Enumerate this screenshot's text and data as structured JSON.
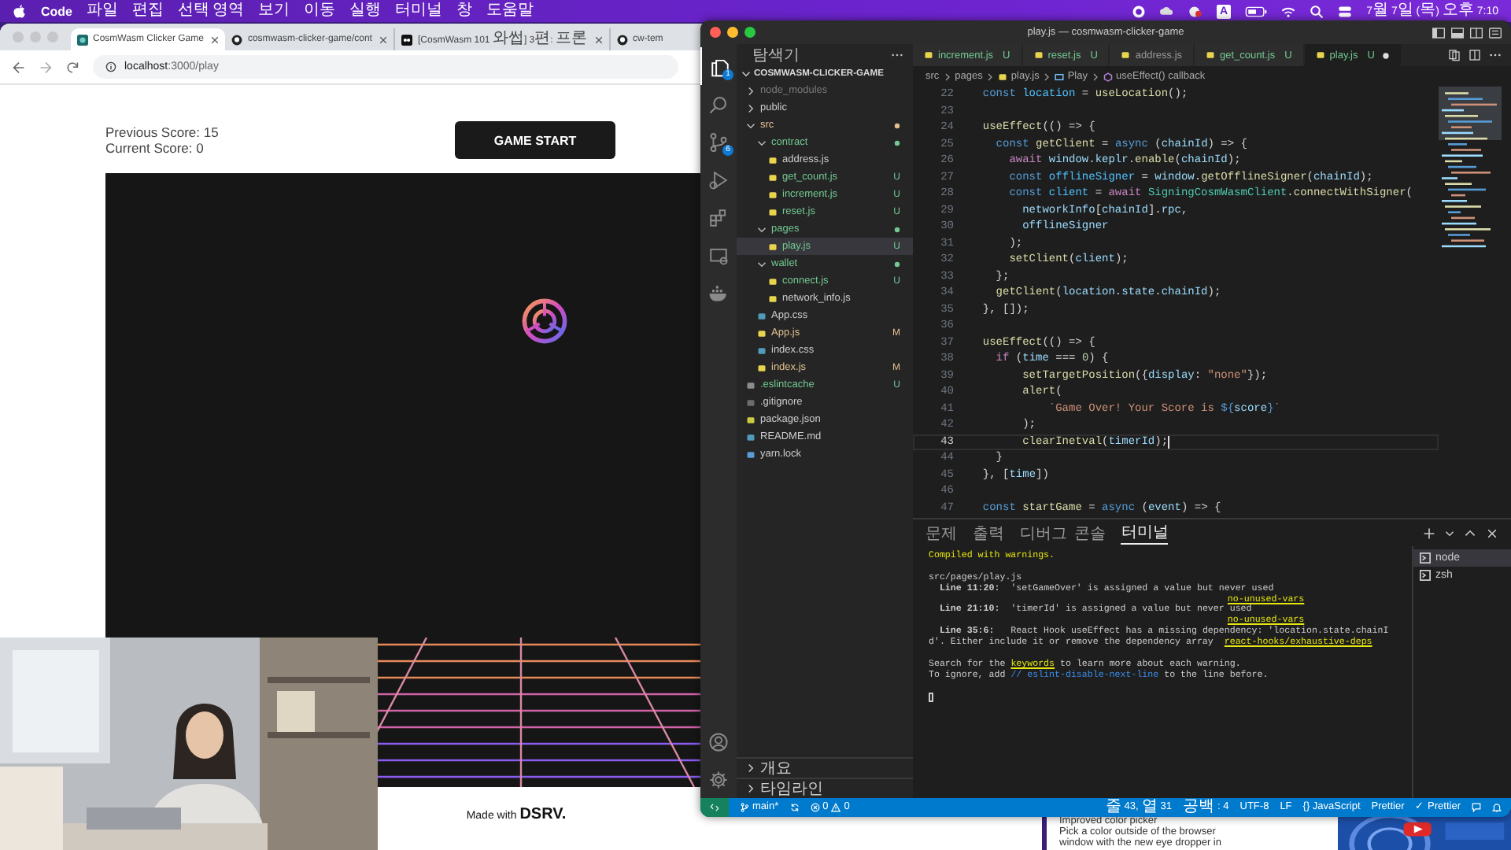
{
  "menu_bar": {
    "app": "Code",
    "items": [
      "파일",
      "편집",
      "선택 영역",
      "보기",
      "이동",
      "실행",
      "터미널",
      "창",
      "도움말"
    ],
    "input_source": "A",
    "clock": "7월 7일 (목) 오후 7:10"
  },
  "browser": {
    "tabs": [
      {
        "title": "CosmWasm Clicker Game",
        "selected": true
      },
      {
        "title": "cosmwasm-clicker-game/cont",
        "selected": false
      },
      {
        "title": "[CosmWasm 101 와썹] 3편: 프론",
        "selected": false
      },
      {
        "title": "cw-tem",
        "selected": false
      }
    ],
    "url": "**localhost**:3000/play",
    "page": {
      "previous_score": "Previous Score: 15",
      "current_score": "Current Score: 0",
      "start_button": "GAME START",
      "footer": "Made with **DSRV.**"
    }
  },
  "background_window": {
    "lines": [
      "Improved color picker",
      "Pick a color outside of the browser",
      "window with the new eye dropper in"
    ]
  },
  "vscode": {
    "title": "play.js — cosmwasm-clicker-game",
    "activity": [
      {
        "selected": true,
        "badge": "1"
      },
      {
        "selected": false
      },
      {
        "selected": false,
        "badge": "6"
      },
      {
        "selected": false
      },
      {
        "selected": false
      },
      {
        "selected": false
      },
      {
        "selected": false
      }
    ],
    "explorer": {
      "title": "탐색기",
      "project": "COSMWASM-CLICKER-GAME",
      "tree": [
        {
          "name": "node_modules",
          "kind": "folder",
          "expanded": false,
          "ignored": true,
          "selected": false
        },
        {
          "name": "public",
          "kind": "folder",
          "expanded": false,
          "selected": false
        },
        {
          "name": "src",
          "kind": "folder",
          "expanded": true,
          "modified": true,
          "selected": false,
          "children": [
            {
              "name": "contract",
              "kind": "folder",
              "expanded": true,
              "untracked": true,
              "selected": false,
              "children": [
                {
                  "name": "address.js",
                  "kind": "js",
                  "selected": false
                },
                {
                  "name": "get_count.js",
                  "kind": "js",
                  "untracked": true,
                  "badge": "U",
                  "selected": false
                },
                {
                  "name": "increment.js",
                  "kind": "js",
                  "untracked": true,
                  "badge": "U",
                  "selected": false
                },
                {
                  "name": "reset.js",
                  "kind": "js",
                  "untracked": true,
                  "badge": "U",
                  "selected": false
                }
              ]
            },
            {
              "name": "pages",
              "kind": "folder",
              "expanded": true,
              "untracked": true,
              "selected": false,
              "children": [
                {
                  "name": "play.js",
                  "kind": "js",
                  "untracked": true,
                  "badge": "U",
                  "selected": true
                }
              ]
            },
            {
              "name": "wallet",
              "kind": "folder",
              "expanded": true,
              "untracked": true,
              "selected": false,
              "children": [
                {
                  "name": "connect.js",
                  "kind": "js",
                  "untracked": true,
                  "badge": "U",
                  "selected": false
                },
                {
                  "name": "network_info.js",
                  "kind": "js",
                  "selected": false
                }
              ]
            },
            {
              "name": "App.css",
              "kind": "css",
              "selected": false
            },
            {
              "name": "App.js",
              "kind": "js",
              "modified": true,
              "badge": "M",
              "selected": false
            },
            {
              "name": "index.css",
              "kind": "css",
              "selected": false
            },
            {
              "name": "index.js",
              "kind": "js",
              "modified": true,
              "badge": "M",
              "selected": false
            }
          ]
        },
        {
          "name": ".eslintcache",
          "kind": "eslint",
          "untracked": true,
          "badge": "U",
          "selected": false
        },
        {
          "name": ".gitignore",
          "kind": "git",
          "selected": false
        },
        {
          "name": "package.json",
          "kind": "json",
          "selected": false
        },
        {
          "name": "README.md",
          "kind": "info",
          "selected": false
        },
        {
          "name": "yarn.lock",
          "kind": "yarn",
          "selected": false
        }
      ],
      "sections": [
        {
          "label": "개요",
          "expanded": false
        },
        {
          "label": "타임라인",
          "expanded": false
        }
      ]
    },
    "tabs": [
      {
        "name": "increment.js",
        "badge": "U",
        "untracked": true,
        "selected": false,
        "dirty": false
      },
      {
        "name": "reset.js",
        "badge": "U",
        "untracked": true,
        "selected": false,
        "dirty": false
      },
      {
        "name": "address.js",
        "selected": false,
        "dirty": false
      },
      {
        "name": "get_count.js",
        "badge": "U",
        "untracked": true,
        "selected": false,
        "dirty": false
      },
      {
        "name": "play.js",
        "badge": "U",
        "untracked": true,
        "selected": true,
        "dirty": true
      }
    ],
    "breadcrumbs": [
      {
        "label": "src",
        "kind": "folder"
      },
      {
        "label": "pages",
        "kind": "folder"
      },
      {
        "label": "play.js",
        "kind": "js"
      },
      {
        "label": "Play",
        "kind": "variable"
      },
      {
        "label": "useEffect() callback",
        "kind": "method"
      }
    ],
    "code": [
      {
        "num": "22",
        "current": false,
        "tokens": [
          {
            "text": "  const",
            "kind": "kw"
          },
          {
            "text": " location",
            "kind": "cn"
          },
          {
            "text": " = ",
            "kind": "p"
          },
          {
            "text": "useLocation",
            "kind": "fn"
          },
          {
            "text": "();",
            "kind": "p"
          }
        ]
      },
      {
        "num": "23",
        "current": false
      },
      {
        "num": "24",
        "current": false,
        "tokens": [
          {
            "text": "  useEffect",
            "kind": "fn"
          },
          {
            "text": "(() => {",
            "kind": "p"
          }
        ]
      },
      {
        "num": "25",
        "current": false,
        "tokens": [
          {
            "text": "    const",
            "kind": "kw"
          },
          {
            "text": " getClient",
            "kind": "fn"
          },
          {
            "text": " = ",
            "kind": "p"
          },
          {
            "text": "async",
            "kind": "kw"
          },
          {
            "text": " (",
            "kind": "p"
          },
          {
            "text": "chainId",
            "kind": "var"
          },
          {
            "text": ") => {",
            "kind": "p"
          }
        ]
      },
      {
        "num": "26",
        "current": false,
        "tokens": [
          {
            "text": "      await",
            "kind": "ctl"
          },
          {
            "text": " window",
            "kind": "var"
          },
          {
            "text": ".",
            "kind": "p"
          },
          {
            "text": "keplr",
            "kind": "var"
          },
          {
            "text": ".",
            "kind": "p"
          },
          {
            "text": "enable",
            "kind": "fn"
          },
          {
            "text": "(",
            "kind": "p"
          },
          {
            "text": "chainId",
            "kind": "var"
          },
          {
            "text": ");",
            "kind": "p"
          }
        ]
      },
      {
        "num": "27",
        "current": false,
        "tokens": [
          {
            "text": "      const",
            "kind": "kw"
          },
          {
            "text": " offlineSigner",
            "kind": "cn"
          },
          {
            "text": " = ",
            "kind": "p"
          },
          {
            "text": "window",
            "kind": "var"
          },
          {
            "text": ".",
            "kind": "p"
          },
          {
            "text": "getOfflineSigner",
            "kind": "fn"
          },
          {
            "text": "(",
            "kind": "p"
          },
          {
            "text": "chainId",
            "kind": "var"
          },
          {
            "text": ");",
            "kind": "p"
          }
        ]
      },
      {
        "num": "28",
        "current": false,
        "tokens": [
          {
            "text": "      const",
            "kind": "kw"
          },
          {
            "text": " client",
            "kind": "cn"
          },
          {
            "text": " = ",
            "kind": "p"
          },
          {
            "text": "await",
            "kind": "ctl"
          },
          {
            "text": " SigningCosmWasmClient",
            "kind": "cls"
          },
          {
            "text": ".",
            "kind": "p"
          },
          {
            "text": "connectWithSigner",
            "kind": "fn"
          },
          {
            "text": "(",
            "kind": "p"
          }
        ]
      },
      {
        "num": "29",
        "current": false,
        "tokens": [
          {
            "text": "        networkInfo",
            "kind": "var"
          },
          {
            "text": "[",
            "kind": "p"
          },
          {
            "text": "chainId",
            "kind": "var"
          },
          {
            "text": "].",
            "kind": "p"
          },
          {
            "text": "rpc",
            "kind": "var"
          },
          {
            "text": ",",
            "kind": "p"
          }
        ]
      },
      {
        "num": "30",
        "current": false,
        "tokens": [
          {
            "text": "        offlineSigner",
            "kind": "var"
          }
        ]
      },
      {
        "num": "31",
        "current": false,
        "tokens": [
          {
            "text": "      );",
            "kind": "p"
          }
        ]
      },
      {
        "num": "32",
        "current": false,
        "tokens": [
          {
            "text": "      setClient",
            "kind": "fn"
          },
          {
            "text": "(",
            "kind": "p"
          },
          {
            "text": "client",
            "kind": "var"
          },
          {
            "text": ");",
            "kind": "p"
          }
        ]
      },
      {
        "num": "33",
        "current": false,
        "tokens": [
          {
            "text": "    };",
            "kind": "p"
          }
        ]
      },
      {
        "num": "34",
        "current": false,
        "tokens": [
          {
            "text": "    getClient",
            "kind": "fn"
          },
          {
            "text": "(",
            "kind": "p"
          },
          {
            "text": "location",
            "kind": "var"
          },
          {
            "text": ".",
            "kind": "p"
          },
          {
            "text": "state",
            "kind": "var"
          },
          {
            "text": ".",
            "kind": "p"
          },
          {
            "text": "chainId",
            "kind": "var"
          },
          {
            "text": ");",
            "kind": "p"
          }
        ]
      },
      {
        "num": "35",
        "current": false,
        "tokens": [
          {
            "text": "  }, []);",
            "kind": "p"
          }
        ]
      },
      {
        "num": "36",
        "current": false
      },
      {
        "num": "37",
        "current": false,
        "tokens": [
          {
            "text": "  useEffect",
            "kind": "fn"
          },
          {
            "text": "(() => {",
            "kind": "p"
          }
        ]
      },
      {
        "num": "38",
        "current": false,
        "tokens": [
          {
            "text": "    if",
            "kind": "ctl"
          },
          {
            "text": " (",
            "kind": "p"
          },
          {
            "text": "time",
            "kind": "var"
          },
          {
            "text": " === ",
            "kind": "p"
          },
          {
            "text": "0",
            "kind": "num"
          },
          {
            "text": ") {",
            "kind": "p"
          }
        ]
      },
      {
        "num": "39",
        "current": false,
        "tokens": [
          {
            "text": "        setTargetPosition",
            "kind": "fn"
          },
          {
            "text": "({",
            "kind": "p"
          },
          {
            "text": "display",
            "kind": "var"
          },
          {
            "text": ": ",
            "kind": "p"
          },
          {
            "text": "\"none\"",
            "kind": "str"
          },
          {
            "text": "});",
            "kind": "p"
          }
        ]
      },
      {
        "num": "40",
        "current": false,
        "tokens": [
          {
            "text": "        alert",
            "kind": "fn"
          },
          {
            "text": "(",
            "kind": "p"
          }
        ]
      },
      {
        "num": "41",
        "current": false,
        "tokens": [
          {
            "text": "            `Game Over! Your Score is ",
            "kind": "str"
          },
          {
            "text": "${",
            "kind": "kw"
          },
          {
            "text": "score",
            "kind": "var"
          },
          {
            "text": "}",
            "kind": "kw"
          },
          {
            "text": "`",
            "kind": "str"
          }
        ]
      },
      {
        "num": "42",
        "current": false,
        "tokens": [
          {
            "text": "        );",
            "kind": "p"
          }
        ]
      },
      {
        "num": "43",
        "current": true,
        "tokens": [
          {
            "text": "        clearInetval",
            "kind": "fn"
          },
          {
            "text": "(",
            "kind": "p"
          },
          {
            "text": "timerId",
            "kind": "var"
          },
          {
            "text": ");",
            "kind": "p"
          }
        ]
      },
      {
        "num": "44",
        "current": false,
        "tokens": [
          {
            "text": "    }",
            "kind": "p"
          }
        ]
      },
      {
        "num": "45",
        "current": false,
        "tokens": [
          {
            "text": "  }, [",
            "kind": "p"
          },
          {
            "text": "time",
            "kind": "var"
          },
          {
            "text": "])",
            "kind": "p"
          }
        ]
      },
      {
        "num": "46",
        "current": false
      },
      {
        "num": "47",
        "current": false,
        "tokens": [
          {
            "text": "  const",
            "kind": "kw"
          },
          {
            "text": " startGame",
            "kind": "fn"
          },
          {
            "text": " = ",
            "kind": "p"
          },
          {
            "text": "async",
            "kind": "kw"
          },
          {
            "text": " (",
            "kind": "p"
          },
          {
            "text": "event",
            "kind": "var"
          },
          {
            "text": ") => {",
            "kind": "p"
          }
        ]
      }
    ],
    "panel_tabs": [
      {
        "label": "문제",
        "selected": false
      },
      {
        "label": "출력",
        "selected": false
      },
      {
        "label": "디버그 콘솔",
        "selected": false
      },
      {
        "label": "터미널",
        "selected": true
      }
    ],
    "terminal": [
      {
        "kind": "text",
        "segments": [
          {
            "text": "Compiled with warnings.",
            "kind": "warn"
          }
        ]
      },
      {
        "kind": "blank"
      },
      {
        "kind": "text",
        "segments": [
          {
            "text": "src/pages/play.js",
            "kind": "plain"
          }
        ]
      },
      {
        "kind": "text",
        "segments": [
          {
            "text": "  Line 11:20:",
            "kind": "bold"
          },
          {
            "text": "  'setGameOver' is assigned a value but never used",
            "kind": "plain"
          }
        ]
      },
      {
        "kind": "rule",
        "segments": [
          {
            "text": "no-unused-vars",
            "kind": "link"
          }
        ]
      },
      {
        "kind": "text",
        "segments": [
          {
            "text": "  Line 21:10:",
            "kind": "bold"
          },
          {
            "text": "  'timerId' is assigned a value but never used",
            "kind": "plain"
          }
        ]
      },
      {
        "kind": "rule",
        "segments": [
          {
            "text": "no-unused-vars",
            "kind": "link"
          }
        ]
      },
      {
        "kind": "text",
        "segments": [
          {
            "text": "  Line 35:6:",
            "kind": "bold"
          },
          {
            "text": "   React Hook useEffect has a missing dependency: 'location.state.chainI",
            "kind": "plain"
          }
        ]
      },
      {
        "kind": "text",
        "segments": [
          {
            "text": "d'. Either include it or remove the dependency array  ",
            "kind": "plain"
          },
          {
            "text": "react-hooks/exhaustive-deps",
            "kind": "link"
          }
        ]
      },
      {
        "kind": "blank"
      },
      {
        "kind": "text",
        "segments": [
          {
            "text": "Search for the ",
            "kind": "plain"
          },
          {
            "text": "keywords",
            "kind": "link"
          },
          {
            "text": " to learn more about each warning.",
            "kind": "plain"
          }
        ]
      },
      {
        "kind": "text",
        "segments": [
          {
            "text": "To ignore, add ",
            "kind": "plain"
          },
          {
            "text": "// eslint-disable-next-line",
            "kind": "comment"
          },
          {
            "text": " to the line before.",
            "kind": "plain"
          }
        ]
      },
      {
        "kind": "blank"
      },
      {
        "kind": "cursor"
      }
    ],
    "terminals": [
      {
        "name": "node",
        "selected": true
      },
      {
        "name": "zsh",
        "selected": false
      }
    ],
    "status": {
      "branch": "main*",
      "errors": "0",
      "warnings": "0",
      "right": [
        "줄 43, 열 31",
        "공백: 4",
        "UTF-8",
        "LF",
        "{} JavaScript",
        "Prettier",
        "✓ Prettier"
      ]
    }
  }
}
